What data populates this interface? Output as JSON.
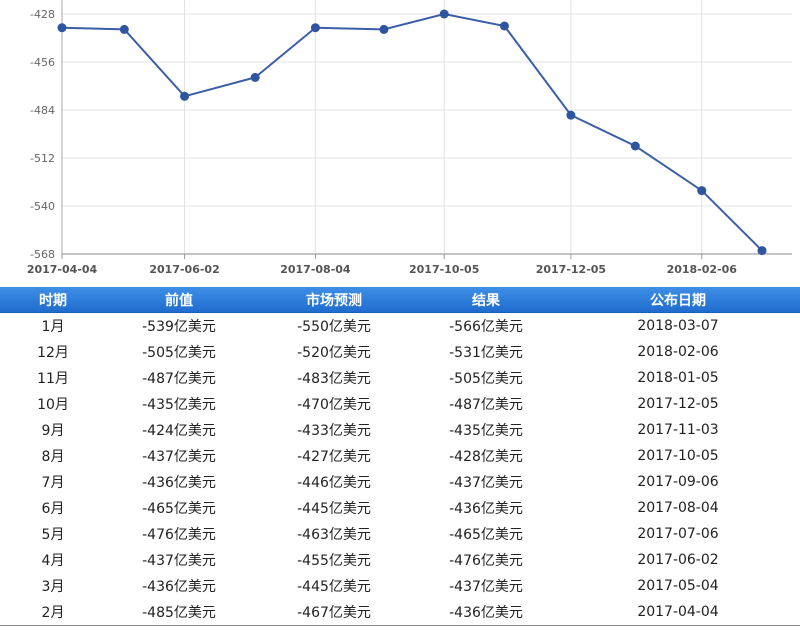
{
  "colors": {
    "line": "#3b5ea8",
    "point": "#2f54a0",
    "grid": "#e3e3e3",
    "header_bg": "#2a7ad8",
    "header_text": "#ffffff"
  },
  "chart_data": {
    "type": "line",
    "title": "",
    "xlabel": "",
    "ylabel": "",
    "ylim": [
      -568,
      -428
    ],
    "yticks": [
      "-428",
      "-456",
      "-484",
      "-512",
      "-540",
      "-568"
    ],
    "xticks": [
      "2017-04-04",
      "2017-06-02",
      "2017-08-04",
      "2017-10-05",
      "2017-12-05",
      "2018-02-06"
    ],
    "grid": true,
    "series": [
      {
        "x": [
          "2017-04-04",
          "2017-05-04",
          "2017-06-02",
          "2017-07-06",
          "2017-08-04",
          "2017-09-06",
          "2017-10-05",
          "2017-11-03",
          "2017-12-05",
          "2018-01-05",
          "2018-02-06",
          "2018-03-07"
        ],
        "values": [
          -436,
          -437,
          -476,
          -465,
          -436,
          -437,
          -428,
          -435,
          -487,
          -505,
          -531,
          -566
        ]
      }
    ]
  },
  "table": {
    "headers": [
      "时期",
      "前值",
      "市场预测",
      "结果",
      "公布日期"
    ],
    "rows": [
      [
        "1月",
        "-539亿美元",
        "-550亿美元",
        "-566亿美元",
        "2018-03-07"
      ],
      [
        "12月",
        "-505亿美元",
        "-520亿美元",
        "-531亿美元",
        "2018-02-06"
      ],
      [
        "11月",
        "-487亿美元",
        "-483亿美元",
        "-505亿美元",
        "2018-01-05"
      ],
      [
        "10月",
        "-435亿美元",
        "-470亿美元",
        "-487亿美元",
        "2017-12-05"
      ],
      [
        "9月",
        "-424亿美元",
        "-433亿美元",
        "-435亿美元",
        "2017-11-03"
      ],
      [
        "8月",
        "-437亿美元",
        "-427亿美元",
        "-428亿美元",
        "2017-10-05"
      ],
      [
        "7月",
        "-436亿美元",
        "-446亿美元",
        "-437亿美元",
        "2017-09-06"
      ],
      [
        "6月",
        "-465亿美元",
        "-445亿美元",
        "-436亿美元",
        "2017-08-04"
      ],
      [
        "5月",
        "-476亿美元",
        "-463亿美元",
        "-465亿美元",
        "2017-07-06"
      ],
      [
        "4月",
        "-437亿美元",
        "-455亿美元",
        "-476亿美元",
        "2017-06-02"
      ],
      [
        "3月",
        "-436亿美元",
        "-445亿美元",
        "-437亿美元",
        "2017-05-04"
      ],
      [
        "2月",
        "-485亿美元",
        "-467亿美元",
        "-436亿美元",
        "2017-04-04"
      ]
    ]
  }
}
